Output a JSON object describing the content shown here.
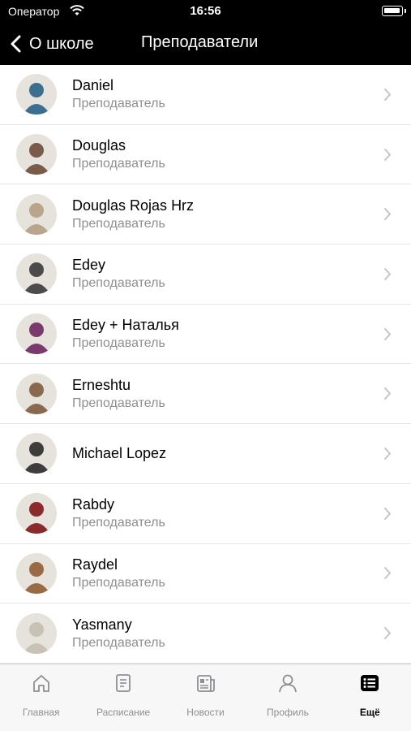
{
  "status_bar": {
    "carrier": "Оператор",
    "time": "16:56"
  },
  "nav": {
    "back_label": "О школе",
    "title": "Преподаватели"
  },
  "teachers": [
    {
      "name": "Daniel",
      "role": "Преподаватель",
      "avatar_color": "#3a6f8f"
    },
    {
      "name": "Douglas",
      "role": "Преподаватель",
      "avatar_color": "#7a5a48"
    },
    {
      "name": "Douglas Rojas Hrz",
      "role": "Преподаватель",
      "avatar_color": "#b8a58c"
    },
    {
      "name": "Edey",
      "role": "Преподаватель",
      "avatar_color": "#4b4b4b"
    },
    {
      "name": "Edey + Наталья",
      "role": "Преподаватель",
      "avatar_color": "#7b3a6e"
    },
    {
      "name": "Erneshtu",
      "role": "Преподаватель",
      "avatar_color": "#8a6a4f"
    },
    {
      "name": "Michael Lopez",
      "role": "",
      "avatar_color": "#3d3d3d"
    },
    {
      "name": "Rabdy",
      "role": "Преподаватель",
      "avatar_color": "#8b2a2a"
    },
    {
      "name": "Raydel",
      "role": "Преподаватель",
      "avatar_color": "#9a6a44"
    },
    {
      "name": "Yasmany",
      "role": "Преподаватель",
      "avatar_color": "#c7c2b5"
    }
  ],
  "tabs": [
    {
      "label": "Главная",
      "icon": "home-icon"
    },
    {
      "label": "Расписание",
      "icon": "schedule-icon"
    },
    {
      "label": "Новости",
      "icon": "news-icon"
    },
    {
      "label": "Профиль",
      "icon": "profile-icon"
    },
    {
      "label": "Ещё",
      "icon": "more-icon",
      "active": true
    }
  ]
}
